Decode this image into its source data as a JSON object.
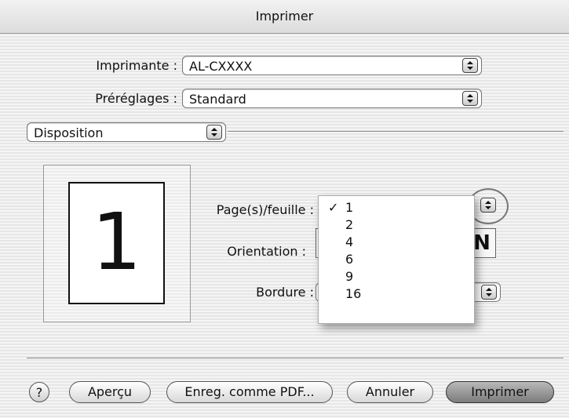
{
  "window": {
    "title": "Imprimer"
  },
  "printer": {
    "label": "Imprimante :",
    "value": "AL-CXXXX"
  },
  "presets": {
    "label": "Préréglages :",
    "value": "Standard"
  },
  "panel": {
    "value": "Disposition"
  },
  "preview": {
    "page_number": "1"
  },
  "pages_per_sheet": {
    "label": "Page(s)/feuille :",
    "options": [
      "1",
      "2",
      "4",
      "6",
      "9",
      "16"
    ],
    "selected": "1",
    "check": "✓"
  },
  "orientation": {
    "label": "Orientation :"
  },
  "border": {
    "label": "Bordure :"
  },
  "buttons": {
    "help": "?",
    "preview": "Aperçu",
    "save_pdf": "Enreg. comme PDF...",
    "cancel": "Annuler",
    "print": "Imprimer"
  }
}
